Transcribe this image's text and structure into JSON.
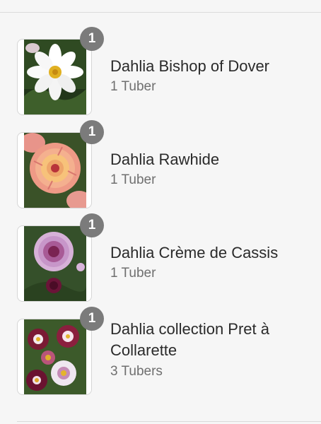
{
  "cart": {
    "items": [
      {
        "name": "Dahlia Bishop of Dover",
        "quantity_text": "1 Tuber",
        "badge": "1",
        "image_icon": "white-dahlia-photo"
      },
      {
        "name": "Dahlia Rawhide",
        "quantity_text": "1 Tuber",
        "badge": "1",
        "image_icon": "peach-dahlia-photo"
      },
      {
        "name": "Dahlia Crème de Cassis",
        "quantity_text": "1 Tuber",
        "badge": "1",
        "image_icon": "purple-dahlia-photo"
      },
      {
        "name": "Dahlia collection Pret à Collarette",
        "quantity_text": "3 Tubers",
        "badge": "1",
        "image_icon": "collarette-dahlias-photo"
      }
    ]
  },
  "colors": {
    "badge": "#7b7b7b",
    "background": "#f6f6f6",
    "name_text": "#2a2a2a",
    "qty_text": "#6f6f6f"
  }
}
